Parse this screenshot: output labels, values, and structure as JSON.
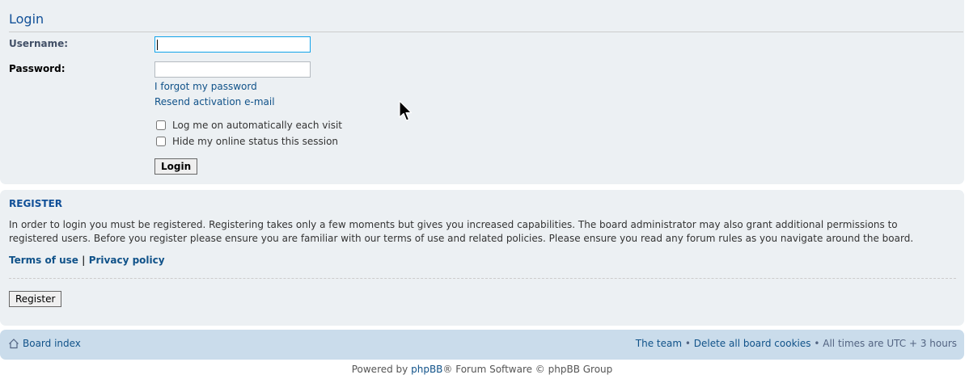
{
  "login": {
    "title": "Login",
    "username_label": "Username:",
    "username_value": "",
    "password_label": "Password:",
    "password_value": "",
    "forgot_password": "I forgot my password",
    "resend_activation": "Resend activation e-mail",
    "autologin_label": "Log me on automatically each visit",
    "hide_online_label": "Hide my online status this session",
    "login_button": "Login"
  },
  "register": {
    "title": "REGISTER",
    "text": "In order to login you must be registered. Registering takes only a few moments but gives you increased capabilities. The board administrator may also grant additional permissions to registered users. Before you register please ensure you are familiar with our terms of use and related policies. Please ensure you read any forum rules as you navigate around the board.",
    "terms_link": "Terms of use",
    "separator": "|",
    "privacy_link": "Privacy policy",
    "register_button": "Register"
  },
  "navbar": {
    "board_index": "Board index",
    "the_team": "The team",
    "bullet": "•",
    "delete_cookies": "Delete all board cookies",
    "timezone": "All times are UTC + 3 hours"
  },
  "footer": {
    "powered_by": "Powered by",
    "phpbb_link": "phpBB",
    "rest": "® Forum Software © phpBB Group"
  },
  "colors": {
    "panel_bg": "#ecf0f3",
    "navbar_bg": "#cadceb",
    "link": "#105289",
    "heading": "#115098"
  },
  "icons": {
    "home": "home-icon",
    "cursor": "mouse-pointer-icon"
  }
}
